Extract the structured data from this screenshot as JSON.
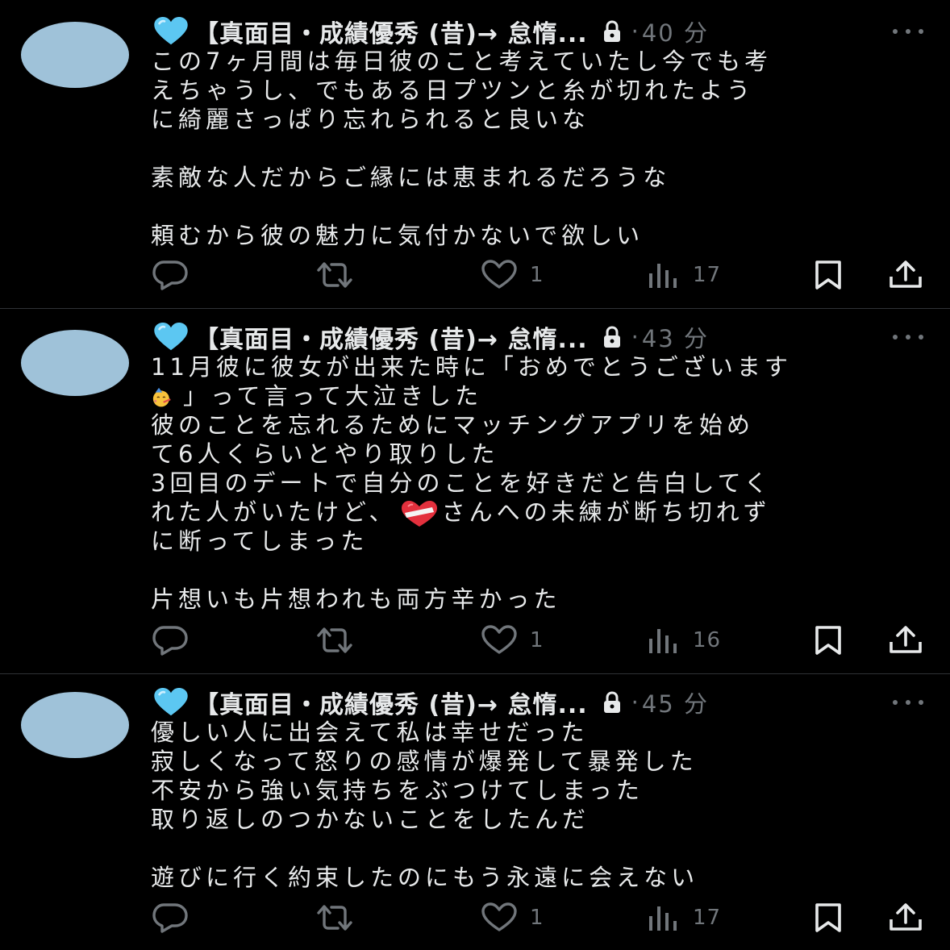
{
  "colors": {
    "background": "#000000",
    "text_primary": "#e7e9ea",
    "text_secondary": "#71767b",
    "divider": "#2f3336",
    "avatar": "#9fc2d9",
    "heart_blue": "#5cc7f2"
  },
  "tweets": [
    {
      "display_name": "【真面目・成績優秀 (昔)→ 怠惰...",
      "name_emoji": "light-blue-heart",
      "protected": true,
      "dot": "·",
      "time": "40 分",
      "lines": [
        "この7ヶ月間は毎日彼のこと考えていたし今でも考",
        "えちゃうし、でもある日プツンと糸が切れたよう",
        "に綺麗さっぱり忘れられると良いな",
        "",
        "素敵な人だからご縁には恵まれるだろうな",
        "",
        "頼むから彼の魅力に気付かないで欲しい"
      ],
      "likes": "1",
      "views": "17"
    },
    {
      "display_name": "【真面目・成績優秀 (昔)→ 怠惰...",
      "name_emoji": "light-blue-heart",
      "protected": true,
      "dot": "·",
      "time": "43 分",
      "lines": [
        "11月彼に彼女が出来た時に「おめでとうございます",
        "」って言って大泣きした",
        "彼のことを忘れるためにマッチングアプリを始め",
        "て6人くらいとやり取りした",
        "3回目のデートで自分のことを好きだと告白してく",
        "れた人がいたけど、",
        "さんへの未練が断ち切れず",
        "に断ってしまった",
        "",
        "片想いも片想われも両方辛かった"
      ],
      "emoji_1": "partying-face",
      "emoji_2": "mending-heart",
      "likes": "1",
      "views": "16"
    },
    {
      "display_name": "【真面目・成績優秀 (昔)→ 怠惰...",
      "name_emoji": "light-blue-heart",
      "protected": true,
      "dot": "·",
      "time": "45 分",
      "lines": [
        "優しい人に出会えて私は幸せだった",
        "寂しくなって怒りの感情が爆発して暴発した",
        "不安から強い気持ちをぶつけてしまった",
        "取り返しのつかないことをしたんだ",
        "",
        "遊びに行く約束したのにもう永遠に会えない"
      ],
      "likes": "1",
      "views": "17"
    }
  ],
  "icons": {
    "reply": "reply-icon",
    "retweet": "retweet-icon",
    "like": "heart-outline-icon",
    "views": "views-icon",
    "bookmark": "bookmark-icon",
    "share": "share-icon",
    "more": "more-icon",
    "lock": "lock-icon"
  }
}
